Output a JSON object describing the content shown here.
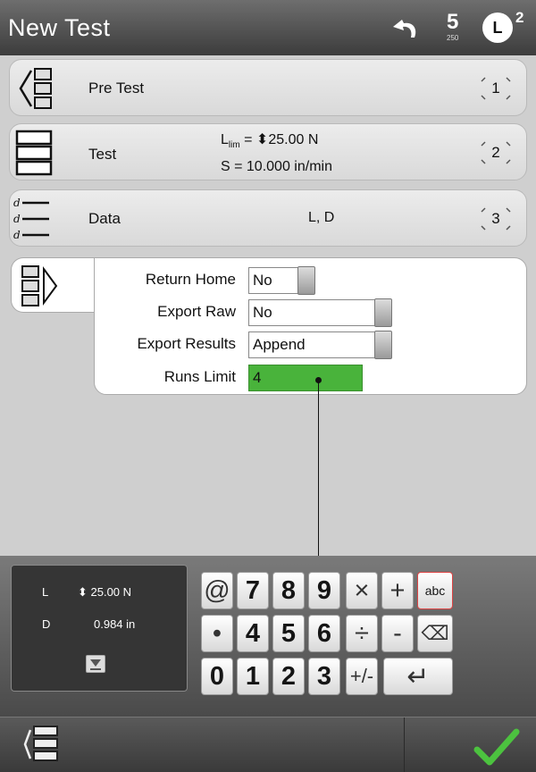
{
  "header": {
    "title": "New Test",
    "counter": "5",
    "counter_sub": "250",
    "load_badge": "L",
    "load_superscript": "2"
  },
  "steps": [
    {
      "name": "Pre Test",
      "number": "1"
    },
    {
      "name": "Test",
      "number": "2",
      "line1_prefix": "L",
      "line1_sub": "lim",
      "line1_rest": " = ⬍25.00 N",
      "line2": "S = 10.000 in/min"
    },
    {
      "name": "Data",
      "number": "3",
      "detail": "L, D"
    }
  ],
  "finish": {
    "rows": [
      {
        "label": "Return Home",
        "value": "No"
      },
      {
        "label": "Export Raw",
        "value": "No"
      },
      {
        "label": "Export Results",
        "value": "Append"
      },
      {
        "label": "Runs Limit",
        "value": "4"
      }
    ]
  },
  "readout": {
    "rows": [
      {
        "key": "L",
        "value": "⬍ 25.00 N"
      },
      {
        "key": "D",
        "value": "0.984 in"
      }
    ]
  },
  "keypad": {
    "row1": [
      "@",
      "7",
      "8",
      "9",
      "×",
      "+",
      "abc"
    ],
    "row2": [
      "•",
      "4",
      "5",
      "6",
      "÷",
      "-",
      "⌫"
    ],
    "row3": [
      "0",
      "1",
      "2",
      "3",
      "+/-",
      "↵"
    ]
  },
  "icons": {
    "undo": "undo-icon",
    "menu": "menu-stack-icon",
    "confirm": "checkmark-icon"
  },
  "colors": {
    "active_field": "#49b33b",
    "confirm": "#4cc23f",
    "abc_border": "#dd4444"
  }
}
